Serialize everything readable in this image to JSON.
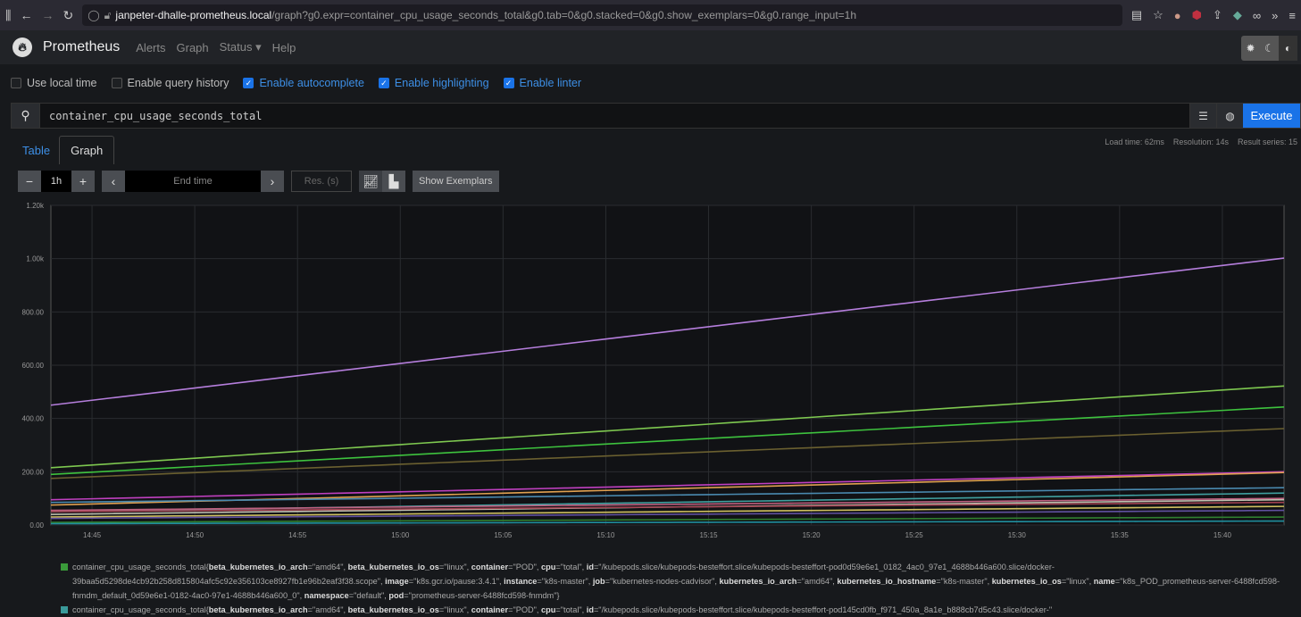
{
  "browser": {
    "url_host": "janpeter-dhalle-prometheus.local",
    "url_path": "/graph?g0.expr=container_cpu_usage_seconds_total&g0.tab=0&g0.stacked=0&g0.show_exemplars=0&g0.range_input=1h"
  },
  "nav": {
    "brand": "Prometheus",
    "items": [
      "Alerts",
      "Graph",
      "Status ▾",
      "Help"
    ]
  },
  "options": [
    {
      "label": "Use local time",
      "checked": false
    },
    {
      "label": "Enable query history",
      "checked": false
    },
    {
      "label": "Enable autocomplete",
      "checked": true
    },
    {
      "label": "Enable highlighting",
      "checked": true
    },
    {
      "label": "Enable linter",
      "checked": true
    }
  ],
  "query": {
    "expr": "container_cpu_usage_seconds_total",
    "execute": "Execute"
  },
  "stats": {
    "load_time": "Load time: 62ms",
    "resolution": "Resolution: 14s",
    "result_series": "Result series: 15"
  },
  "tabs": {
    "table": "Table",
    "graph": "Graph"
  },
  "controls": {
    "range": "1h",
    "end_time_placeholder": "End time",
    "res_placeholder": "Res. (s)",
    "show_exemplars": "Show Exemplars"
  },
  "chart_data": {
    "type": "line",
    "y_ticks": [
      "0.00",
      "200.00",
      "400.00",
      "600.00",
      "800.00",
      "1.00k",
      "1.20k"
    ],
    "ylim": [
      0,
      1200
    ],
    "x_ticks": [
      "14:45",
      "14:50",
      "14:55",
      "15:00",
      "15:05",
      "15:10",
      "15:15",
      "15:20",
      "15:25",
      "15:30",
      "15:35",
      "15:40"
    ],
    "xlim": [
      "14:43",
      "15:43"
    ],
    "grid": true,
    "series": [
      {
        "color": "#b57edc",
        "values": [
          450,
          1002
        ]
      },
      {
        "color": "#7ec850",
        "values": [
          215,
          522
        ]
      },
      {
        "color": "#3ec23e",
        "values": [
          190,
          443
        ]
      },
      {
        "color": "#6b6030",
        "values": [
          175,
          362
        ]
      },
      {
        "color": "#c040c0",
        "values": [
          95,
          200
        ]
      },
      {
        "color": "#e0a050",
        "values": [
          75,
          197
        ]
      },
      {
        "color": "#4a8ab0",
        "values": [
          85,
          140
        ]
      },
      {
        "color": "#40a0a0",
        "values": [
          50,
          120
        ]
      },
      {
        "color": "#c06080",
        "values": [
          55,
          100
        ]
      },
      {
        "color": "#c0c0b0",
        "values": [
          40,
          95
        ]
      },
      {
        "color": "#a04050",
        "values": [
          50,
          85
        ]
      },
      {
        "color": "#d0c060",
        "values": [
          30,
          70
        ]
      },
      {
        "color": "#6050a0",
        "values": [
          25,
          55
        ]
      },
      {
        "color": "#308030",
        "values": [
          10,
          30
        ]
      },
      {
        "color": "#2090a0",
        "values": [
          5,
          15
        ]
      }
    ]
  },
  "legend": [
    {
      "color": "#3a9a3a",
      "metric": "container_cpu_usage_seconds_total",
      "labels": [
        [
          "beta_kubernetes_io_arch",
          "amd64"
        ],
        [
          "beta_kubernetes_io_os",
          "linux"
        ],
        [
          "container",
          "POD"
        ],
        [
          "cpu",
          "total"
        ],
        [
          "id",
          "/kubepods.slice/kubepods-besteffort.slice/kubepods-besteffort-pod0d59e6e1_0182_4ac0_97e1_4688b446a600.slice/docker-39baa5d5298de4cb92b258d815804afc5c92e356103ce8927fb1e96b2eaf3f38.scope"
        ],
        [
          "image",
          "k8s.gcr.io/pause:3.4.1"
        ],
        [
          "instance",
          "k8s-master"
        ],
        [
          "job",
          "kubernetes-nodes-cadvisor"
        ],
        [
          "kubernetes_io_arch",
          "amd64"
        ],
        [
          "kubernetes_io_hostname",
          "k8s-master"
        ],
        [
          "kubernetes_io_os",
          "linux"
        ],
        [
          "name",
          "k8s_POD_prometheus-server-6488fcd598-fnmdm_default_0d59e6e1-0182-4ac0-97e1-4688b446a600_0"
        ],
        [
          "namespace",
          "default"
        ],
        [
          "pod",
          "prometheus-server-6488fcd598-fnmdm"
        ]
      ]
    },
    {
      "color": "#3a9a9a",
      "metric": "container_cpu_usage_seconds_total",
      "labels": [
        [
          "beta_kubernetes_io_arch",
          "amd64"
        ],
        [
          "beta_kubernetes_io_os",
          "linux"
        ],
        [
          "container",
          "POD"
        ],
        [
          "cpu",
          "total"
        ],
        [
          "id",
          "/kubepods.slice/kubepods-besteffort.slice/kubepods-besteffort-pod145cd0fb_f971_450a_8a1e_b888cb7d5c43.slice/docker-"
        ]
      ]
    }
  ]
}
